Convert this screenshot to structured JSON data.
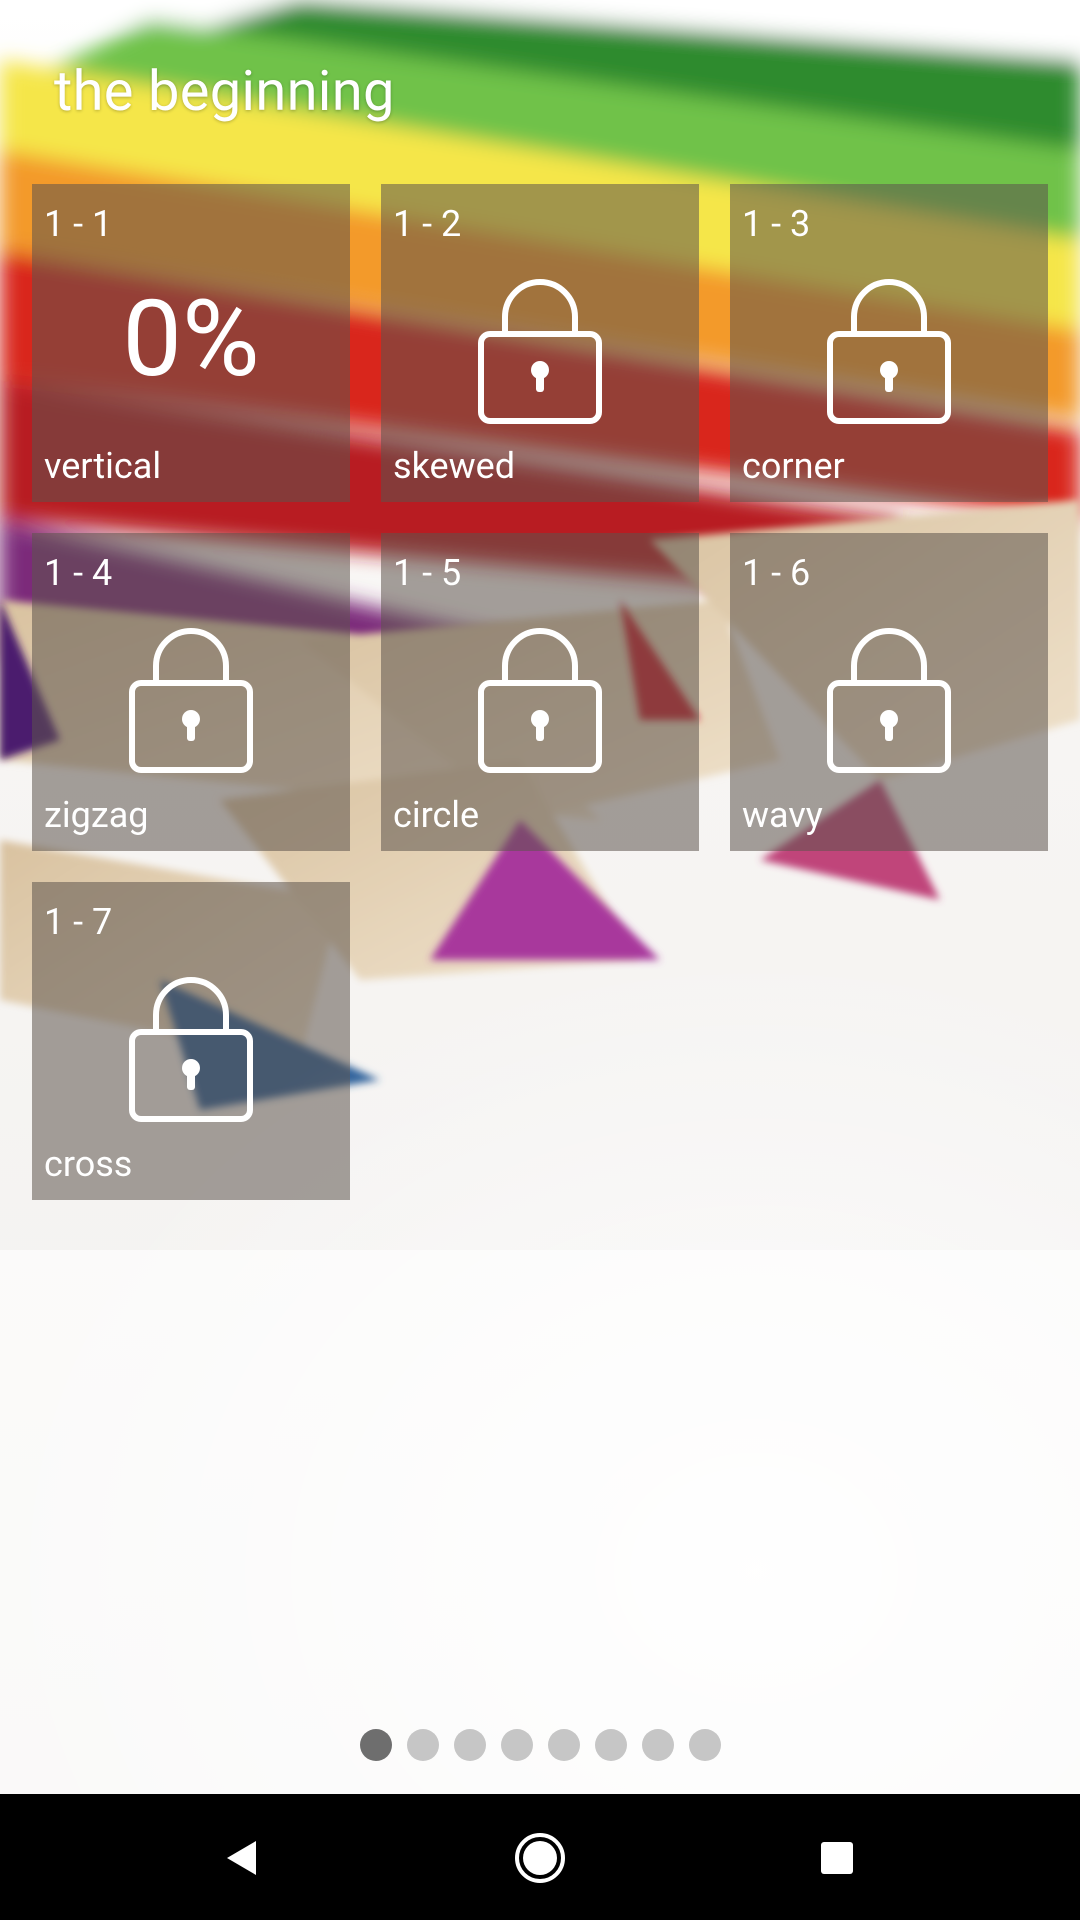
{
  "header": {
    "title": "the beginning"
  },
  "levels": [
    {
      "number": "1 - 1",
      "name": "vertical",
      "status": "unlocked",
      "progress": "0%"
    },
    {
      "number": "1 - 2",
      "name": "skewed",
      "status": "locked"
    },
    {
      "number": "1 - 3",
      "name": "corner",
      "status": "locked"
    },
    {
      "number": "1 - 4",
      "name": "zigzag",
      "status": "locked"
    },
    {
      "number": "1 - 5",
      "name": "circle",
      "status": "locked"
    },
    {
      "number": "1 - 6",
      "name": "wavy",
      "status": "locked"
    },
    {
      "number": "1 - 7",
      "name": "cross",
      "status": "locked"
    }
  ],
  "pager": {
    "page_count": 8,
    "current_page": 1
  },
  "navigation_bar": {
    "buttons": [
      "back-icon",
      "home-icon",
      "recents-icon"
    ]
  },
  "colors": {
    "tile_overlay": "#5c544c",
    "dot_active": "#6e6e6e",
    "dot_inactive": "#c6c6c6",
    "nav_background": "#000000"
  }
}
